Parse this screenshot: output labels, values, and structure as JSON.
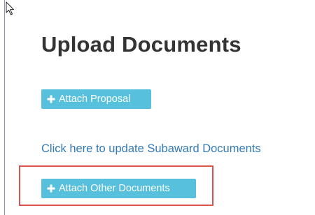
{
  "page": {
    "title": "Upload Documents"
  },
  "buttons": {
    "attach_proposal_label": "Attach Proposal",
    "attach_other_label": "Attach Other Documents"
  },
  "links": {
    "subaward_label": "Click here to update Subaward Documents"
  },
  "icons": {
    "cursor": "mouse-pointer-icon",
    "plus": "plus-icon"
  },
  "colors": {
    "button_bg": "#56c0dd",
    "link": "#337ab7",
    "title": "#333333",
    "highlight": "#d9534f"
  }
}
